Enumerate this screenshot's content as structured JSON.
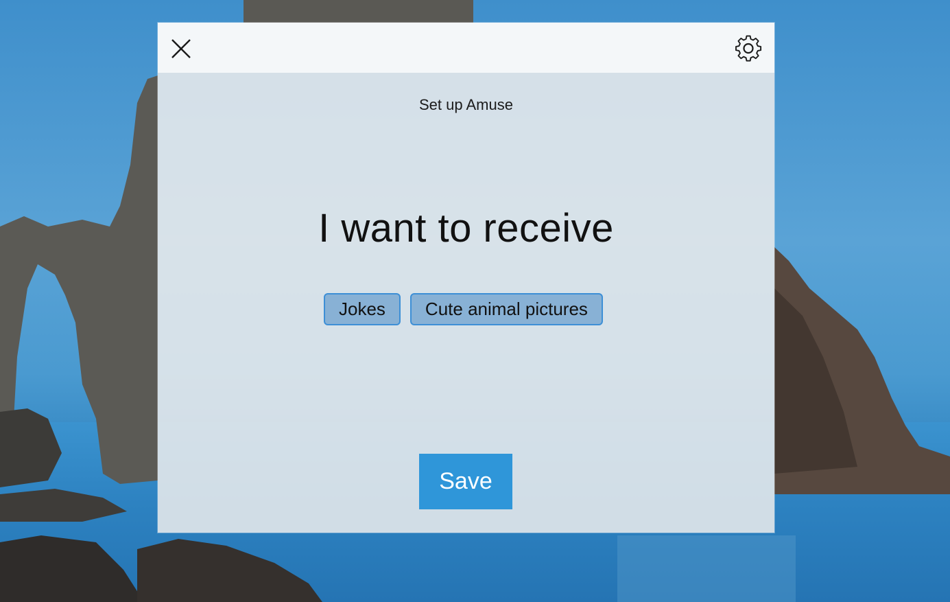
{
  "dialog": {
    "subtitle": "Set up Amuse",
    "heading": "I want to receive",
    "chips": [
      {
        "label": "Jokes",
        "selected": true
      },
      {
        "label": "Cute animal pictures",
        "selected": true
      }
    ],
    "save_label": "Save"
  },
  "icons": {
    "close": "close-icon",
    "settings": "gear-icon"
  },
  "colors": {
    "accent": "#2f96d9",
    "chip_border": "#3d8fd6",
    "chip_fill": "#6ea0cd"
  }
}
